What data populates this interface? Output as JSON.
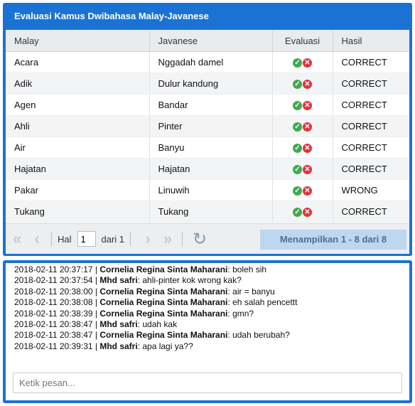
{
  "grid": {
    "title": "Evaluasi Kamus Dwibahasa Malay-Javanese",
    "columns": [
      "Malay",
      "Javanese",
      "Evaluasi",
      "Hasil"
    ],
    "rows": [
      {
        "malay": "Acara",
        "javanese": "Nggadah damel",
        "hasil": "CORRECT"
      },
      {
        "malay": "Adik",
        "javanese": "Dulur kandung",
        "hasil": "CORRECT"
      },
      {
        "malay": "Agen",
        "javanese": "Bandar",
        "hasil": "CORRECT"
      },
      {
        "malay": "Ahli",
        "javanese": "Pinter",
        "hasil": "CORRECT"
      },
      {
        "malay": "Air",
        "javanese": "Banyu",
        "hasil": "CORRECT"
      },
      {
        "malay": "Hajatan",
        "javanese": "Hajatan",
        "hasil": "CORRECT"
      },
      {
        "malay": "Pakar",
        "javanese": "Linuwih",
        "hasil": "WRONG"
      },
      {
        "malay": "Tukang",
        "javanese": "Tukang",
        "hasil": "CORRECT"
      }
    ],
    "icons": {
      "correct": "check-circle-icon",
      "wrong": "x-circle-icon"
    },
    "colors": {
      "header": "#1a73d4",
      "correct": "#3fab4a",
      "wrong": "#e0343f"
    }
  },
  "pager": {
    "page_label": "Hal",
    "page_value": "1",
    "of_label": "dari 1",
    "display_info": "Menampilkan 1 - 8 dari 8"
  },
  "chat": {
    "messages": [
      {
        "time": "2018-02-11 20:37:17",
        "user": "Cornelia Regina Sinta Maharani",
        "text": "boleh sih"
      },
      {
        "time": "2018-02-11 20:37:54",
        "user": "Mhd safri",
        "text": "ahli-pinter kok wrong kak?"
      },
      {
        "time": "2018-02-11 20:38:00",
        "user": "Cornelia Regina Sinta Maharani",
        "text": "air = banyu"
      },
      {
        "time": "2018-02-11 20:38:08",
        "user": "Cornelia Regina Sinta Maharani",
        "text": "eh salah pencettt"
      },
      {
        "time": "2018-02-11 20:38:39",
        "user": "Cornelia Regina Sinta Maharani",
        "text": "gmn?"
      },
      {
        "time": "2018-02-11 20:38:47",
        "user": "Mhd safri",
        "text": "udah kak"
      },
      {
        "time": "2018-02-11 20:38:47",
        "user": "Cornelia Regina Sinta Maharani",
        "text": "udah berubah?"
      },
      {
        "time": "2018-02-11 20:39:31",
        "user": "Mhd safri",
        "text": "apa lagi ya??"
      }
    ],
    "input_placeholder": "Ketik pesan..."
  }
}
